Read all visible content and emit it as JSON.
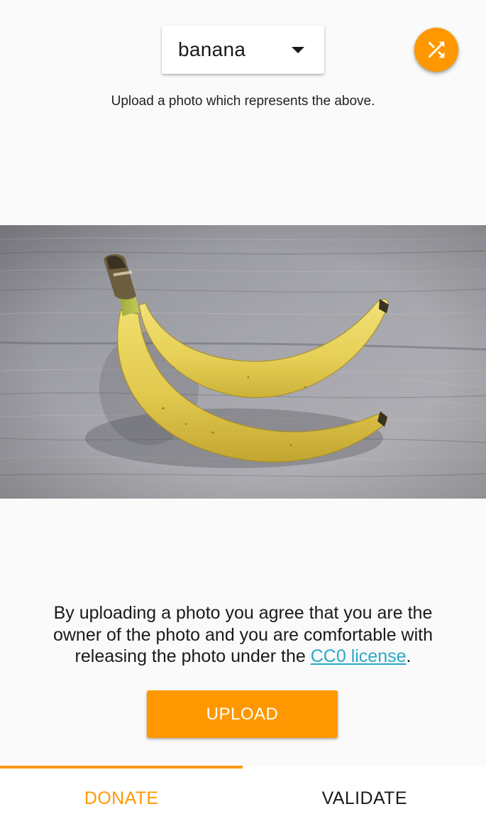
{
  "label_picker": {
    "selected": "banana"
  },
  "shuffle_button": {
    "icon": "shuffle-icon"
  },
  "instruction": "Upload a photo which represents the above.",
  "photo": {
    "subject": "banana"
  },
  "consent": {
    "text_before": "By uploading a photo you agree that you are the owner of the photo and you are comfortable with releasing the photo under the ",
    "link_text": "CC0 license",
    "text_after": "."
  },
  "upload_button": {
    "label": "UPLOAD"
  },
  "tabs": [
    {
      "label": "DONATE",
      "active": true
    },
    {
      "label": "VALIDATE",
      "active": false
    }
  ],
  "colors": {
    "accent": "#ff9800",
    "link": "#29a9c9",
    "background": "#fafafa"
  }
}
